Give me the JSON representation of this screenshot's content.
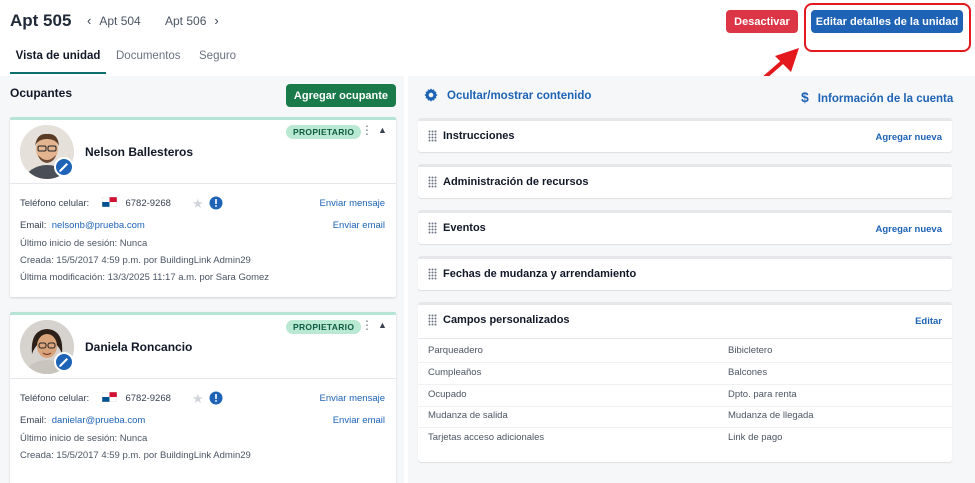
{
  "header": {
    "title": "Apt 505",
    "prev_unit": "Apt 504",
    "next_unit": "Apt 506",
    "deactivate_label": "Desactivar",
    "edit_label": "Editar detalles de la unidad"
  },
  "tabs": [
    {
      "label": "Vista de unidad",
      "active": true
    },
    {
      "label": "Documentos",
      "active": false
    },
    {
      "label": "Seguro",
      "active": false
    }
  ],
  "occupants": {
    "title": "Ocupantes",
    "add_label": "Agregar ocupante",
    "items": [
      {
        "name": "Nelson Ballesteros",
        "badge": "PROPIETARIO",
        "phone_label": "Teléfono celular:",
        "phone": "6782-9268",
        "email_label": "Email:",
        "email": "nelsonb@prueba.com",
        "last_login": "Último inicio de sesión:  Nunca",
        "created": "Creada:  15/5/2017 4:59 p.m. por BuildingLink Admin29",
        "modified": "Última modificación:  13/3/2025 11:17 a.m. por Sara Gomez",
        "send_message": "Enviar mensaje",
        "send_email": "Enviar email"
      },
      {
        "name": "Daniela Roncancio",
        "badge": "PROPIETARIO",
        "phone_label": "Teléfono celular:",
        "phone": "6782-9268",
        "email_label": "Email:",
        "email": "danielar@prueba.com",
        "last_login": "Último inicio de sesión:  Nunca",
        "created": "Creada:  15/5/2017 4:59 p.m. por BuildingLink Admin29",
        "send_message": "Enviar mensaje",
        "send_email": "Enviar email"
      }
    ]
  },
  "right": {
    "toggle_label": "Ocultar/mostrar contenido",
    "account_label": "Información de la cuenta",
    "sections": [
      {
        "title": "Instrucciones",
        "action": "Agregar nueva"
      },
      {
        "title": "Administración de recursos",
        "action": ""
      },
      {
        "title": "Eventos",
        "action": "Agregar nueva"
      },
      {
        "title": "Fechas de mudanza y arrendamiento",
        "action": ""
      },
      {
        "title": "Campos personalizados",
        "action": "Editar"
      }
    ],
    "custom_fields": [
      [
        "Parqueadero",
        "Bibicletero"
      ],
      [
        "Cumpleaños",
        "Balcones"
      ],
      [
        "Ocupado",
        "Dpto. para renta"
      ],
      [
        "Mudanza de salida",
        "Mudanza de llegada"
      ],
      [
        "Tarjetas acceso adicionales",
        "Link de pago"
      ]
    ]
  },
  "colors": {
    "primary": "#1e63b5",
    "danger": "#dc3545",
    "success": "#1a7a4a",
    "badge_bg": "#b9e8d3",
    "highlight": "#e3191d"
  }
}
